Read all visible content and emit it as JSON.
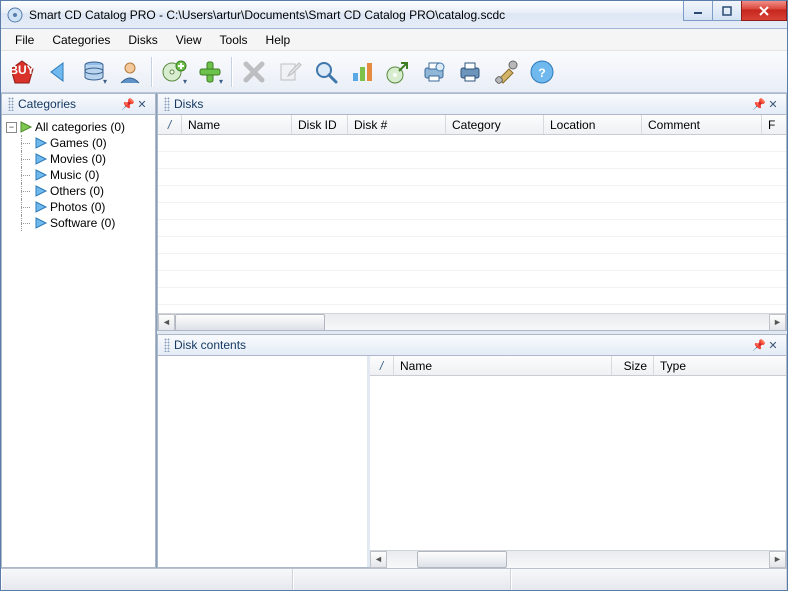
{
  "window": {
    "title": "Smart CD Catalog PRO - C:\\Users\\artur\\Documents\\Smart CD Catalog PRO\\catalog.scdc"
  },
  "menu": [
    "File",
    "Categories",
    "Disks",
    "View",
    "Tools",
    "Help"
  ],
  "panels": {
    "categories_title": "Categories",
    "disks_title": "Disks",
    "contents_title": "Disk contents"
  },
  "tree": {
    "root": "All categories (0)",
    "items": [
      "Games (0)",
      "Movies (0)",
      "Music (0)",
      "Others (0)",
      "Photos (0)",
      "Software (0)"
    ]
  },
  "disks_columns": {
    "c0": "/",
    "c1": "Name",
    "c2": "Disk ID",
    "c3": "Disk #",
    "c4": "Category",
    "c5": "Location",
    "c6": "Comment",
    "c7": "F"
  },
  "contents_columns": {
    "c0": "/",
    "c1": "Name",
    "c2": "Size",
    "c3": "Type"
  },
  "toolbar_icons": {
    "buy": "buy-icon",
    "back": "back-icon",
    "database": "database-icon",
    "user": "user-icon",
    "add_disk": "add-disk-icon",
    "add": "add-icon",
    "delete": "delete-icon",
    "edit": "edit-icon",
    "search": "search-icon",
    "chart": "chart-icon",
    "export": "export-icon",
    "print_preview": "print-preview-icon",
    "print": "print-icon",
    "settings": "settings-icon",
    "help": "help-icon"
  }
}
